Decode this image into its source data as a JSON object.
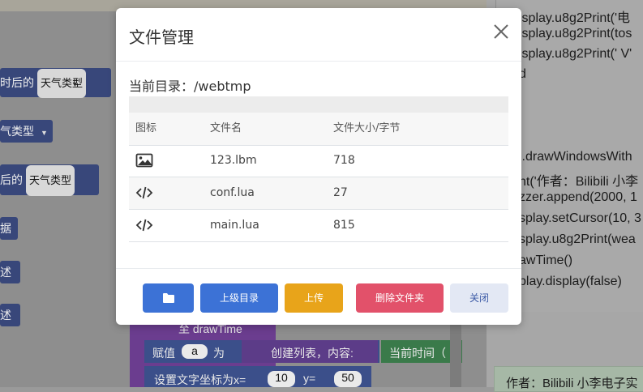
{
  "background": {
    "left_blocks": [
      {
        "text": "时后的",
        "dropdown": "天气类型"
      },
      {
        "text": "气类型",
        "dropdown": ""
      },
      {
        "text": "后的",
        "dropdown": "天气类型"
      },
      {
        "text": "据"
      },
      {
        "text": "述"
      },
      {
        "text": "述"
      }
    ],
    "code_lines": [
      "isplay.u8g2Print('电",
      "isplay.u8g2Print(tos",
      "isplay.u8g2Print(' V'",
      "d",
      "i.drawWindowsWith",
      "nt('作者：Bilibili 小李",
      "zzer.append(2000, 1",
      "splay.setCursor(10, 3",
      "splay.u8g2Print(wea",
      "awTime()",
      "play.display(false)"
    ],
    "author_text": "作者：Bilibili 小李电子实",
    "bottom_blocks": {
      "func_label": "至 drawTime",
      "assign_label": "赋值",
      "assign_var": "a",
      "assign_as": "为",
      "create_list": "创建列表，内容:",
      "current_time": "当前时间（",
      "set_cursor": "设置文字坐标为x=",
      "x_val": "10",
      "y_label": "y=",
      "y_val": "50"
    }
  },
  "modal": {
    "title": "文件管理",
    "current_dir_label": "当前目录：",
    "current_dir": "/webtmp",
    "columns": [
      "图标",
      "文件名",
      "文件大小/字节"
    ],
    "files": [
      {
        "icon": "image-icon",
        "name": "123.lbm",
        "size": "718"
      },
      {
        "icon": "code-icon",
        "name": "conf.lua",
        "size": "27"
      },
      {
        "icon": "code-icon",
        "name": "main.lua",
        "size": "815"
      }
    ],
    "buttons": {
      "parent": "上级目录",
      "upload": "上传",
      "delete": "删除文件夹",
      "close": "关闭"
    }
  },
  "colors": {
    "primary": "#3c72d6",
    "warning": "#e8a41a",
    "danger": "#e2516a",
    "light": "#e3e8f4"
  }
}
